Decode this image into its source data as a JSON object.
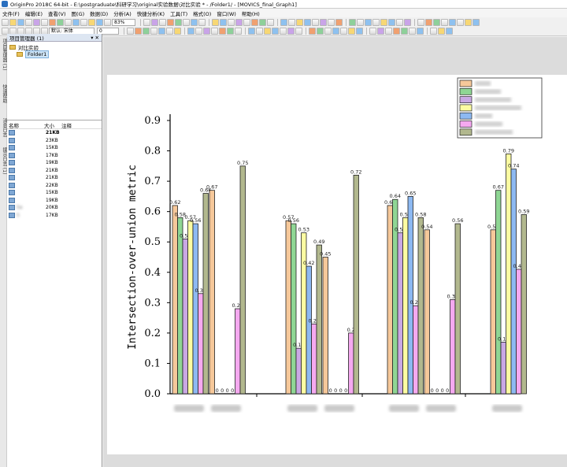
{
  "window": {
    "title": "OriginPro 2018C 64-bit - E:\\postgraduate\\科研学习\\original实验数据\\对比实验 * - /Folder1/ - [MOVICS_final_Graph1]"
  },
  "menu": [
    "文件(F)",
    "编辑(E)",
    "查看(V)",
    "图(G)",
    "数据(D)",
    "分析(A)",
    "快捷分析(K)",
    "工具(T)",
    "格式(O)",
    "窗口(W)",
    "帮助(H)"
  ],
  "toolbar": {
    "zoom": "83%",
    "font_name": "默认: 宋体",
    "font_size": "0"
  },
  "side_tabs": [
    "项目管理器 (1)",
    "快速帮助",
    "消息日志",
    "提示日志 (1)"
  ],
  "project_manager": {
    "title": "项目管理器 (1)",
    "pin": "▾ ✕",
    "root": "对比实验",
    "folder": "Folder1",
    "columns": [
      "名称",
      "大小",
      "注释"
    ],
    "files": [
      {
        "name": "",
        "size": "21KB",
        "bold": true
      },
      {
        "name": "",
        "size": "23KB"
      },
      {
        "name": "",
        "size": "15KB"
      },
      {
        "name": "",
        "size": "17KB"
      },
      {
        "name": "",
        "size": "19KB"
      },
      {
        "name": "",
        "size": "21KB"
      },
      {
        "name": "",
        "size": "21KB"
      },
      {
        "name": "",
        "size": "22KB"
      },
      {
        "name": "",
        "size": "15KB"
      },
      {
        "name": "",
        "size": "19KB"
      },
      {
        "name": "Sa",
        "size": "20KB"
      },
      {
        "name": "S",
        "size": "17KB"
      }
    ]
  },
  "chart_data": {
    "type": "bar",
    "ylabel": "Intersection-over-union metric",
    "ylim": [
      0,
      0.9
    ],
    "yticks": [
      "0.0",
      "0.1",
      "0.2",
      "0.3",
      "0.4",
      "0.5",
      "0.6",
      "0.7",
      "0.8",
      "0.9"
    ],
    "colors": [
      "#f6c89a",
      "#8fd694",
      "#c9a8e4",
      "#fcfca2",
      "#8db9f2",
      "#f5a9f0",
      "#b2b88e"
    ],
    "series": [
      {
        "values": [
          0.62,
          0.67,
          0.57,
          0.45,
          0.62,
          0.54,
          0.54
        ]
      },
      {
        "values": [
          0.58,
          0.0,
          0.56,
          0.0,
          0.64,
          0.0,
          0.67
        ]
      },
      {
        "values": [
          0.51,
          0.0,
          0.15,
          0.0,
          0.53,
          0.0,
          0.17
        ]
      },
      {
        "values": [
          0.57,
          0.0,
          0.53,
          0.0,
          0.58,
          0.0,
          0.79
        ]
      },
      {
        "values": [
          0.56,
          0.0,
          0.42,
          0.0,
          0.65,
          0.0,
          0.74
        ]
      },
      {
        "values": [
          0.33,
          0.28,
          0.23,
          0.2,
          0.29,
          0.31,
          0.41
        ]
      },
      {
        "values": [
          0.66,
          0.75,
          0.49,
          0.72,
          0.58,
          0.56,
          0.59
        ]
      }
    ],
    "labels": [
      [
        "0.62",
        "0.58",
        "0.51",
        "0.57",
        "0.56",
        "0.33",
        "0.66"
      ],
      [
        "0.67",
        "0",
        "0",
        "0",
        "0",
        "0.28",
        "0.75"
      ],
      [
        "0.57",
        "0.56",
        "0.15",
        "0.53",
        "0.42",
        "0.23",
        "0.49"
      ],
      [
        "0.45",
        "0",
        "0",
        "0",
        "0",
        "0.2",
        "0.72"
      ],
      [
        "0.62",
        "0.64",
        "0.53",
        "0.58",
        "0.65",
        "0.29",
        "0.58"
      ],
      [
        "0.54",
        "0",
        "0",
        "0",
        "0",
        "0.31",
        "0.56"
      ],
      [
        "0.54",
        "0.67",
        "0.17",
        "0.79",
        "0.74",
        "0.41",
        "0.59"
      ]
    ],
    "legend": "top-right",
    "grid": false
  }
}
